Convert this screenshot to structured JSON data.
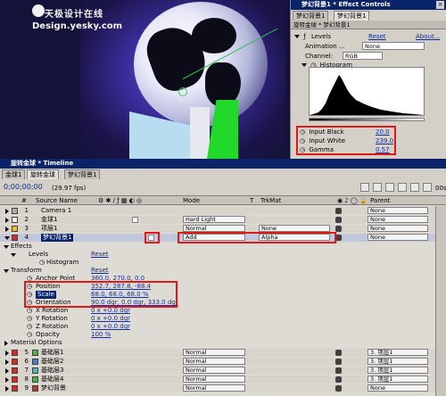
{
  "watermark": {
    "line1": "天极设计在线",
    "line2": "Design.yesky.com"
  },
  "effect_controls": {
    "title": "梦幻背景1 * Effect Controls",
    "tabs": [
      "梦幻背景1",
      "梦幻背景1"
    ],
    "path": "旋转金球 * 梦幻背景1",
    "levels": {
      "label": "Levels",
      "reset": "Reset",
      "about": "About..."
    },
    "animation_presets": {
      "label": "Animation ...",
      "value": "None"
    },
    "channel": {
      "label": "Channel:",
      "value": "RGB"
    },
    "histogram": {
      "label": "Histogram"
    },
    "input_black": {
      "label": "Input Black",
      "value": "20.0"
    },
    "input_white": {
      "label": "Input White",
      "value": "239.0"
    },
    "gamma": {
      "label": "Gamma",
      "value": "0.57"
    }
  },
  "timeline": {
    "title": "旋转金球 * Timeline",
    "tabs": [
      "金球1",
      "旋转金球",
      "梦幻背景1"
    ],
    "current_time": "0;00;00;00",
    "fps": "(29.97 fps)",
    "headers": {
      "source_name": "Source Name",
      "mode": "Mode",
      "t": "T",
      "trkmat": "TrkMat",
      "parent": "Parent"
    },
    "layers_top": [
      {
        "index": "1",
        "name": "Camera 1",
        "mode": "",
        "trk": "",
        "parent": "None",
        "color": "#b0b0b0"
      },
      {
        "index": "2",
        "name": "金球1",
        "mode": "Hard Light",
        "trk": "",
        "parent": "None",
        "color": "#f0f0f0"
      },
      {
        "index": "3",
        "name": "项层1",
        "mode": "Normal",
        "trk": "None",
        "parent": "None",
        "color": "#f0c030"
      },
      {
        "index": "4",
        "name": "梦幻背景1",
        "mode": "Add",
        "trk": "Alpha",
        "parent": "None",
        "color": "#c83030"
      }
    ],
    "effects": {
      "label": "Effects",
      "levels": "Levels",
      "levels_reset": "Reset",
      "histogram": "Histogram"
    },
    "transform": {
      "label": "Transform",
      "reset": "Reset",
      "props": [
        {
          "name": "Anchor Point",
          "value": "360.0, 270.0, 0.0"
        },
        {
          "name": "Position",
          "value": "352.7, 287.8, -88.4"
        },
        {
          "name": "Scale",
          "value": "68.0, 68.0, 68.0 %"
        },
        {
          "name": "Orientation",
          "value": "90.0 dgr, 0.0 dgr, 333.0 dgr"
        },
        {
          "name": "X Rotation",
          "value": "0 x +0.0 dgr"
        },
        {
          "name": "Y Rotation",
          "value": "0 x +0.0 dgr"
        },
        {
          "name": "Z Rotation",
          "value": "0 x +0.0 dgr"
        },
        {
          "name": "Opacity",
          "value": "100 %"
        }
      ]
    },
    "material_options": "Material Options",
    "layers_bottom": [
      {
        "index": "5",
        "name": "基础层1",
        "mode": "Normal",
        "trk": "",
        "parent": "3. 项层1",
        "color": "#40b840"
      },
      {
        "index": "6",
        "name": "基础层2",
        "mode": "Normal",
        "trk": "",
        "parent": "3. 项层1",
        "color": "#4080e0"
      },
      {
        "index": "7",
        "name": "基础层3",
        "mode": "Normal",
        "trk": "",
        "parent": "3. 项层1",
        "color": "#40c0c0"
      },
      {
        "index": "8",
        "name": "基础层4",
        "mode": "Normal",
        "trk": "",
        "parent": "3. 项层1",
        "color": "#40b840"
      },
      {
        "index": "9",
        "name": "梦幻背景",
        "mode": "Normal",
        "trk": "",
        "parent": "None",
        "color": "#c83030"
      }
    ],
    "ruler_label": "00s"
  }
}
